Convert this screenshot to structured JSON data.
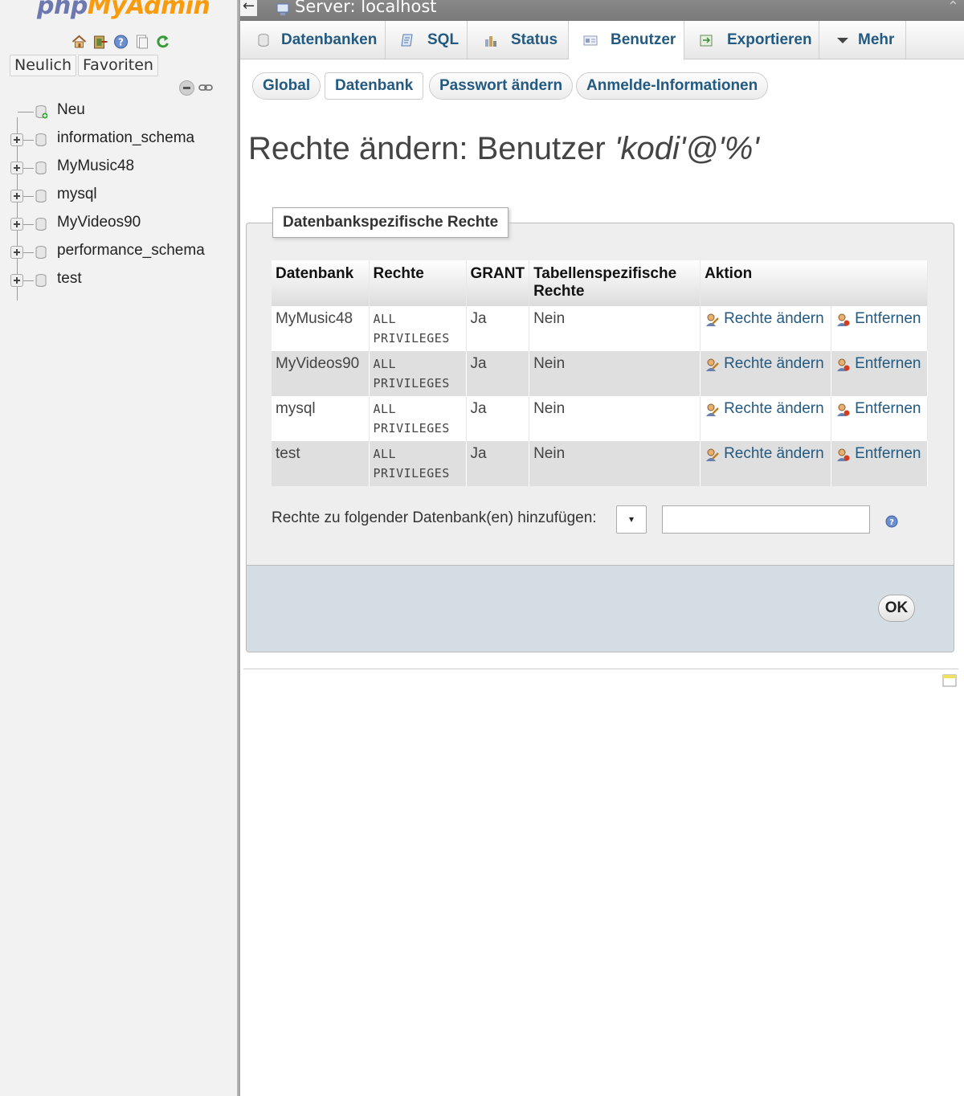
{
  "nav": {
    "logo_php": "php",
    "logo_myadmin": "MyAdmin",
    "icons": [
      "home-icon",
      "logout-icon",
      "help-icon",
      "docs-icon",
      "reload-icon"
    ],
    "tabs": [
      "Neulich",
      "Favoriten"
    ],
    "tree": [
      {
        "label": "Neu",
        "type": "new"
      },
      {
        "label": "information_schema",
        "type": "db"
      },
      {
        "label": "MyMusic48",
        "type": "db"
      },
      {
        "label": "mysql",
        "type": "db"
      },
      {
        "label": "MyVideos90",
        "type": "db"
      },
      {
        "label": "performance_schema",
        "type": "db"
      },
      {
        "label": "test",
        "type": "db"
      }
    ]
  },
  "serverbar": {
    "back": "←",
    "server": "Server: localhost",
    "collapse": "⌃"
  },
  "topmenu": {
    "tabs": [
      {
        "label": "Datenbanken",
        "icon": "database-icon"
      },
      {
        "label": "SQL",
        "icon": "sql-icon"
      },
      {
        "label": "Status",
        "icon": "status-icon"
      },
      {
        "label": "Benutzer",
        "icon": "users-icon",
        "active": true
      },
      {
        "label": "Exportieren",
        "icon": "export-icon"
      },
      {
        "label": "Mehr",
        "icon": "caret-down-icon"
      }
    ]
  },
  "subtabs": [
    "Global",
    "Datenbank",
    "Passwort ändern",
    "Anmelde-Informationen"
  ],
  "title": {
    "prefix": "Rechte ändern: Benutzer ",
    "user": "'kodi'@'%'"
  },
  "fieldset": {
    "legend": "Datenbankspezifische Rechte",
    "columns": [
      "Datenbank",
      "Rechte",
      "GRANT",
      "Tabellenspezifische Rechte",
      "Aktion"
    ],
    "rows": [
      {
        "db": "MyMusic48",
        "privs": "ALL PRIVILEGES",
        "grant": "Ja",
        "table_privs": "Nein",
        "edit": "Rechte ändern",
        "remove": "Entfernen"
      },
      {
        "db": "MyVideos90",
        "privs": "ALL PRIVILEGES",
        "grant": "Ja",
        "table_privs": "Nein",
        "edit": "Rechte ändern",
        "remove": "Entfernen"
      },
      {
        "db": "mysql",
        "privs": "ALL PRIVILEGES",
        "grant": "Ja",
        "table_privs": "Nein",
        "edit": "Rechte ändern",
        "remove": "Entfernen"
      },
      {
        "db": "test",
        "privs": "ALL PRIVILEGES",
        "grant": "Ja",
        "table_privs": "Nein",
        "edit": "Rechte ändern",
        "remove": "Entfernen"
      }
    ],
    "add_label": "Rechte zu folgender Datenbank(en) hinzufügen:",
    "select_value": "▾",
    "input_value": ""
  },
  "footer": {
    "ok": "OK"
  },
  "colors": {
    "link": "#235a81",
    "logo_php": "#6c78af",
    "logo_myadmin": "#f89c0e",
    "footer_bg": "#d4dce4"
  }
}
